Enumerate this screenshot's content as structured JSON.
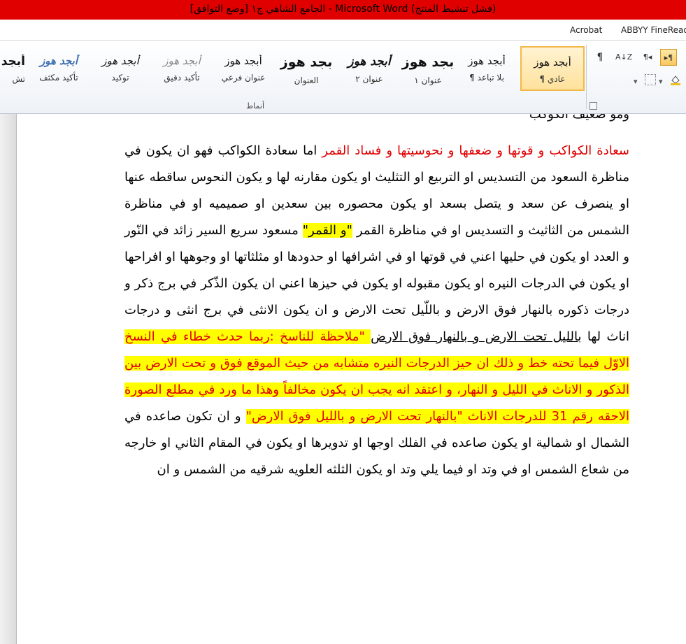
{
  "window": {
    "title": "الجامع الشاهي ج١ [وضع التوافق] - Microsoft Word (فشل تنشيط المنتج)"
  },
  "tabs": [
    "ABBYY FineRead",
    "Acrobat"
  ],
  "ribbon": {
    "styles_group_label": "أنماط",
    "styles": [
      {
        "sample": "أبجد هوز",
        "name": "¶ عادي",
        "selected": true
      },
      {
        "sample": "أبجد هوز",
        "name": "¶ بلا تباعد"
      },
      {
        "sample": "بجد هوز",
        "name": "عنوان ١"
      },
      {
        "sample": "أبجد هوز",
        "name": "عنوان ٢"
      },
      {
        "sample": "بجد هوز",
        "name": "العنوان"
      },
      {
        "sample": "أبجد هوز",
        "name": "عنوان فرعي"
      },
      {
        "sample": "أبجد هوز",
        "name": "تأكيد دقيق"
      },
      {
        "sample": "أبجد هوز",
        "name": "توكيد"
      },
      {
        "sample": "أبجد هوز",
        "name": "تأكيد مكثف"
      },
      {
        "sample": "أبجد",
        "name": "تش"
      }
    ],
    "paragraph_buttons": {
      "pilcrow": "¶",
      "sort": "A↓Z",
      "ltr": "¶◂",
      "rtl": "▸¶"
    }
  },
  "document": {
    "top_cut_line": "ومو ضعيف الكوكب",
    "segments": {
      "s1_red": "سعادة الكواكب و قوتها و ضعفها و نحوسيتها و فساد القمر",
      "s2": " اما سعادة الكواكب فهو ان يكون في مناظرة السعود من التسديس او التربيع او التثليث او يكون مقارنه لها و يكون النحوس ساقطه عنها او ينصرف عن سعد و يتصل بسعد او يكون محصوره بين سعدين او صميميه او في مناظرة الشمس من الثاثيث و التسديس او في مناظرة القمر ",
      "s3_hl": "\"و القمر\"",
      "s4": " مسعود سريع السير زائد في النّور و العدد او يكون في حليها اعني في قوتها او في اشرافها او حدودها او مثلثاتها او وجوهها او افراحها او يكون في الدرجات النيره او يكون مقبوله او يكون في حيزها اعني ان يكون الذّكر في برج ذكر و درجات ذكوره بالنهار فوق الارض و باللّيل تحت الارض و ان يكون الانثى في برج انثى و درجات اناث لها ",
      "s5_ul": "بالليل تحت الارض و بالنهار فوق الارض",
      "s6_red_hl": " \"ملاحظة للناسخ :ربما حدث خطاء في النسخ الاوّل فيما تحته خط و ذلك ان حيز الدرجات النيره متشابه من حيث الموقع فوق و تحت الارض بين الذكور و الاناث في الليل و النهار، و اعتقد انه يجب ان يكون مخالفاً وهذا ما ورد في مطلع الصورة الاحقه رقم 31 للدرجات الاناث \"بالنهار تحت الارض و بالليل فوق الارض\"",
      "s7": " و ان تكون صاعده في الشمال او شمالية او يكون صاعده في الفلك اوجها او تدويرها او يكون في المقام الثاني او خارجه من شعاع الشمس او في وتد او فيما يلي وتد او يكون الثلثه العلويه شرقيه من الشمس و ان"
    }
  }
}
